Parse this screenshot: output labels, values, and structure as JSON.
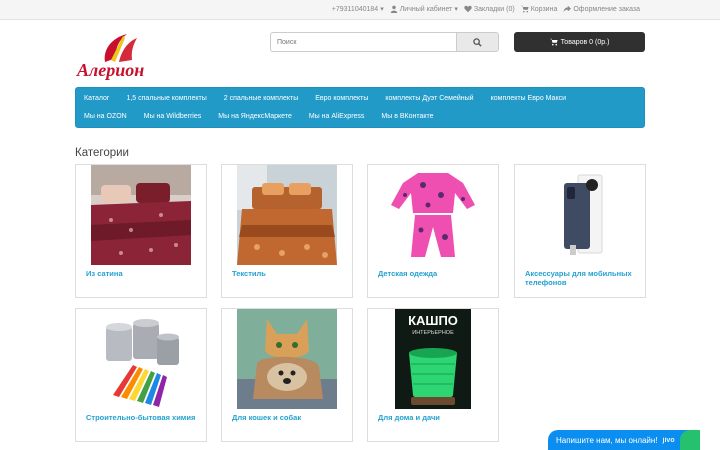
{
  "top": {
    "phone": "+79311040184",
    "account": "Личный кабинет",
    "bookmarks": "Закладки (0)",
    "cart": "Корзина",
    "checkout": "Оформление заказа"
  },
  "header": {
    "logo_text": "Алерион",
    "search_placeholder": "Поиск",
    "cart_button": "Товаров 0 (0р.)"
  },
  "menu": [
    "Каталог",
    "1,5 спальные комплекты",
    "2 спальные комплекты",
    "Евро комплекты",
    "комплекты Дуэт Семейный",
    "комплекты Евро Макси",
    "Мы на OZON",
    "Мы на Wildberries",
    "Мы на ЯндексМаркете",
    "Мы на AliExpress",
    "Мы в ВКонтакте"
  ],
  "categories_title": "Категории",
  "categories": [
    {
      "name": "Из сатина",
      "icon": "bedding-photo"
    },
    {
      "name": "Текстиль",
      "icon": "bedding-photo"
    },
    {
      "name": "Детская одежда",
      "icon": "pajamas-photo"
    },
    {
      "name": "Аксессуары для мобильных телефонов",
      "icon": "phone-case-photo"
    },
    {
      "name": "Строительно-бытовая химия",
      "icon": "paint-cans-photo"
    },
    {
      "name": "Для кошек и собак",
      "icon": "cat-dog-photo"
    },
    {
      "name": "Для дома и дачи",
      "icon": "planter-photo"
    }
  ],
  "product_image_text": {
    "planter_title": "КАШПО",
    "planter_subtitle": "ИНТЕРЬЕРНОЕ"
  },
  "chat": {
    "message": "Напишите нам, мы онлайн!",
    "brand": "jivo"
  },
  "colors": {
    "menu_bg": "#229ac8",
    "link": "#23a1d1",
    "cart_bg": "#303030",
    "logo_red": "#c8102e",
    "chat_blue": "#0c8ef0"
  }
}
